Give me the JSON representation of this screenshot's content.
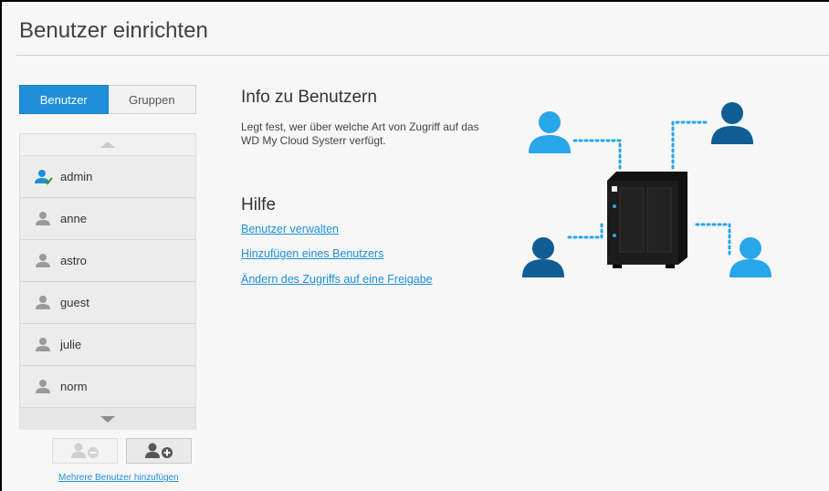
{
  "page": {
    "title": "Benutzer einrichten"
  },
  "tabs": [
    {
      "label": "Benutzer",
      "active": true
    },
    {
      "label": "Gruppen",
      "active": false
    }
  ],
  "users": [
    {
      "name": "admin",
      "is_admin": true
    },
    {
      "name": "anne",
      "is_admin": false
    },
    {
      "name": "astro",
      "is_admin": false
    },
    {
      "name": "guest",
      "is_admin": false
    },
    {
      "name": "julie",
      "is_admin": false
    },
    {
      "name": "norm",
      "is_admin": false
    }
  ],
  "actions": {
    "remove_icon": "remove-user-icon",
    "add_icon": "add-user-icon",
    "multi_link": "Mehrere Benutzer hinzufügen"
  },
  "info": {
    "title": "Info zu Benutzern",
    "text": "Legt fest, wer über welche Art von Zugriff auf das WD My Cloud Systerr verfügt."
  },
  "help": {
    "title": "Hilfe",
    "links": [
      "Benutzer verwalten",
      "Hinzufügen eines Benutzers",
      "Ändern des Zugriffs auf eine Freigabe"
    ]
  },
  "colors": {
    "accent": "#1e8fd8",
    "user_light": "#27a6ea",
    "user_dark": "#0e5d93",
    "device": "#1a1a1a",
    "admin_check": "#2a9a3a"
  }
}
